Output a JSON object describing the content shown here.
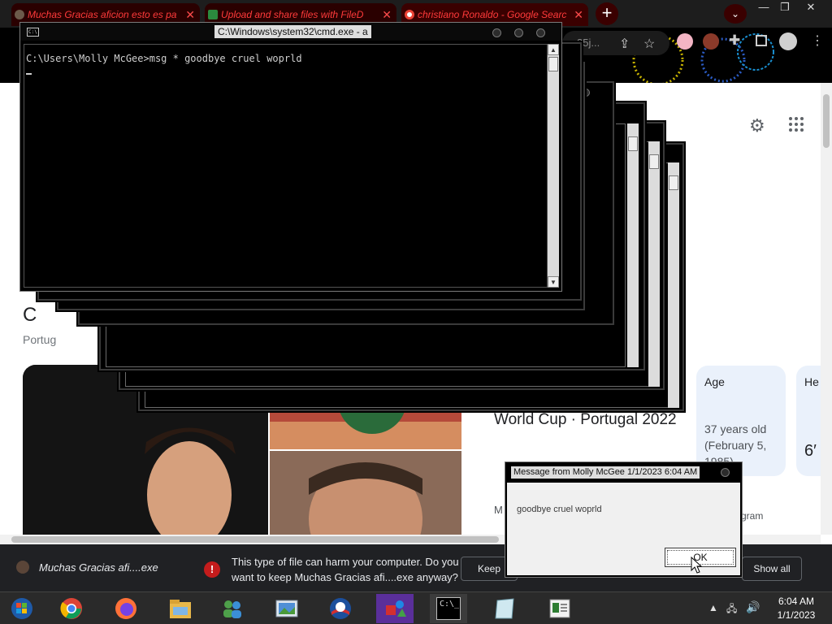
{
  "browser": {
    "tabs": [
      {
        "label": "Muchas Gracias aficion esto es pa"
      },
      {
        "label": "Upload and share files with FileD"
      },
      {
        "label": "christiano Ronaldo - Google Searc"
      }
    ],
    "new_tab": "+",
    "omnibox_tail": "35j...",
    "window_controls": {
      "minimize": "—",
      "restore": "❐",
      "close": "✕"
    }
  },
  "google": {
    "subtitle_letter": "C",
    "subtitle": "Portug",
    "worldcup_title": "World Cup · Portugal 2022",
    "age_card": {
      "label": "Age",
      "value": "37 years old (February 5, 1985)"
    },
    "height_card": {
      "label": "He",
      "value": "6′"
    },
    "instagram": "gram",
    "m_text": "M"
  },
  "downloads": {
    "file_name": "Muchas Gracias afi....exe",
    "warning": "This type of file can harm your computer. Do you want to keep Muchas Gracias afi....exe anyway?",
    "keep": "Keep",
    "show_all": "Show all"
  },
  "cmd": {
    "title": "C:\\Windows\\system32\\cmd.exe - a",
    "prompt_line": "C:\\Users\\Molly McGee>msg * goodbye cruel woprld",
    "icon_text": "C:\\"
  },
  "msgbox": {
    "title": "Message from Molly McGee 1/1/2023 6:04 AM",
    "message": "goodbye cruel woprld",
    "ok": "OK"
  },
  "taskbar": {
    "clock_time": "6:04 AM",
    "clock_date": "1/1/2023",
    "cmd_icon_text": "C:\\_"
  },
  "colors": {
    "tab_text": "#ff3a3a",
    "taskbar": "#2a2a2a",
    "download_bar": "#202124",
    "warning_red": "#c41c1c"
  }
}
